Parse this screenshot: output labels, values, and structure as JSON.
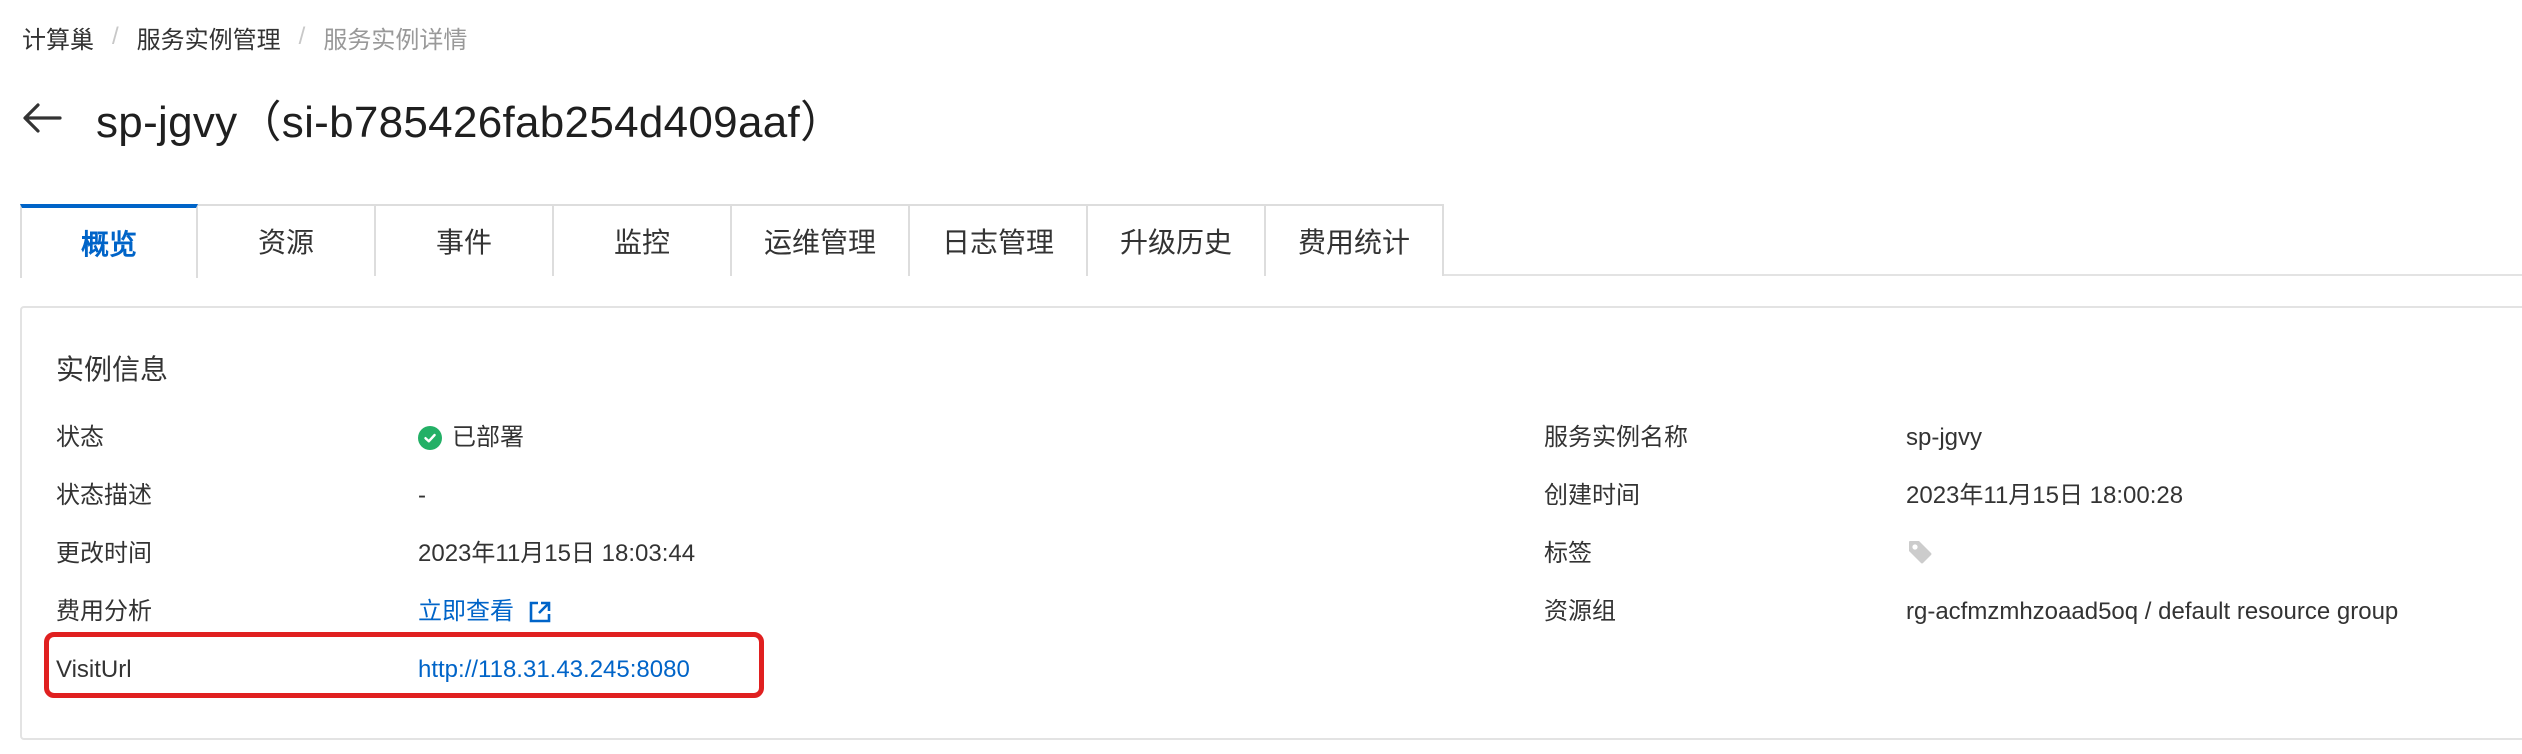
{
  "breadcrumb": {
    "items": [
      "计算巢",
      "服务实例管理",
      "服务实例详情"
    ],
    "separator": "/"
  },
  "header": {
    "title": "sp-jgvy（si-b785426fab254d409aaf）"
  },
  "tabs": [
    {
      "label": "概览",
      "active": true
    },
    {
      "label": "资源",
      "active": false
    },
    {
      "label": "事件",
      "active": false
    },
    {
      "label": "监控",
      "active": false
    },
    {
      "label": "运维管理",
      "active": false
    },
    {
      "label": "日志管理",
      "active": false
    },
    {
      "label": "升级历史",
      "active": false
    },
    {
      "label": "费用统计",
      "active": false
    }
  ],
  "instance_info": {
    "title": "实例信息",
    "left": [
      {
        "label": "状态",
        "value": "已部署"
      },
      {
        "label": "状态描述",
        "value": "-"
      },
      {
        "label": "更改时间",
        "value": "2023年11月15日 18:03:44"
      },
      {
        "label": "费用分析",
        "value": "立即查看"
      },
      {
        "label": "VisitUrl",
        "value": "http://118.31.43.245:8080"
      }
    ],
    "right": [
      {
        "label": "服务实例名称",
        "value": "sp-jgvy"
      },
      {
        "label": "创建时间",
        "value": "2023年11月15日 18:00:28"
      },
      {
        "label": "标签",
        "value": ""
      },
      {
        "label": "资源组",
        "value": "rg-acfmzmhzoaad5oq / default resource group"
      }
    ]
  },
  "colors": {
    "accent": "#0064c8",
    "status_success": "#23b066",
    "highlight": "#e02020",
    "muted": "#999999"
  },
  "icons": {
    "back": "arrow-left-icon",
    "status": "check-circle-icon",
    "external": "external-link-icon",
    "tag": "tag-icon"
  }
}
